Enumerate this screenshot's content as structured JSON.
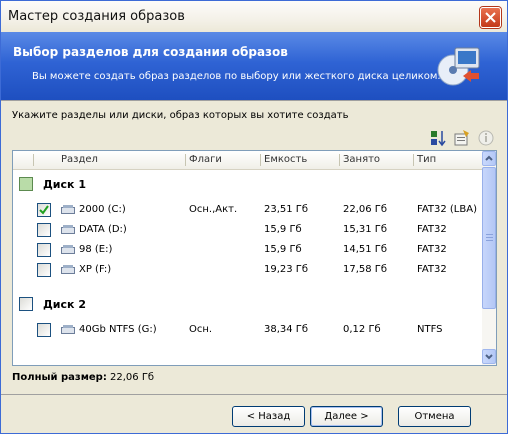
{
  "window": {
    "title": "Мастер создания образов"
  },
  "header": {
    "title": "Выбор разделов для создания образов",
    "subtitle": "Вы можете создать образ разделов по выбору или жесткого диска целиком."
  },
  "instruction": "Укажите разделы или диски, образ которых вы хотите создать",
  "columns": [
    "Раздел",
    "Флаги",
    "Емкость",
    "Занято",
    "Тип"
  ],
  "disks": [
    {
      "label": "Диск 1",
      "partitions": [
        {
          "name": "2000 (C:)",
          "flags": "Осн.,Акт.",
          "capacity": "23,51 Гб",
          "used": "22,06 Гб",
          "type": "FAT32 (LBA)",
          "checked": true
        },
        {
          "name": "DATA (D:)",
          "flags": "",
          "capacity": "15,9 Гб",
          "used": "15,31 Гб",
          "type": "FAT32",
          "checked": false
        },
        {
          "name": "98 (E:)",
          "flags": "",
          "capacity": "15,9 Гб",
          "used": "14,51 Гб",
          "type": "FAT32",
          "checked": false
        },
        {
          "name": "XP (F:)",
          "flags": "",
          "capacity": "19,23 Гб",
          "used": "17,58 Гб",
          "type": "FAT32",
          "checked": false
        }
      ]
    },
    {
      "label": "Диск 2",
      "partitions": [
        {
          "name": "40Gb NTFS (G:)",
          "flags": "Осн.",
          "capacity": "38,34 Гб",
          "used": "0,12 Гб",
          "type": "NTFS",
          "checked": false
        }
      ]
    }
  ],
  "total": {
    "label": "Полный размер:",
    "value": "22,06 Гб"
  },
  "buttons": {
    "back": "< Назад",
    "next": "Далее >",
    "cancel": "Отмена"
  },
  "toolbar": {
    "icons": [
      "sort-icon",
      "properties-icon",
      "info-icon"
    ]
  },
  "colors": {
    "header_blue": "#2f63d4",
    "window_border": "#3d6bd6",
    "face": "#ece9d8"
  }
}
